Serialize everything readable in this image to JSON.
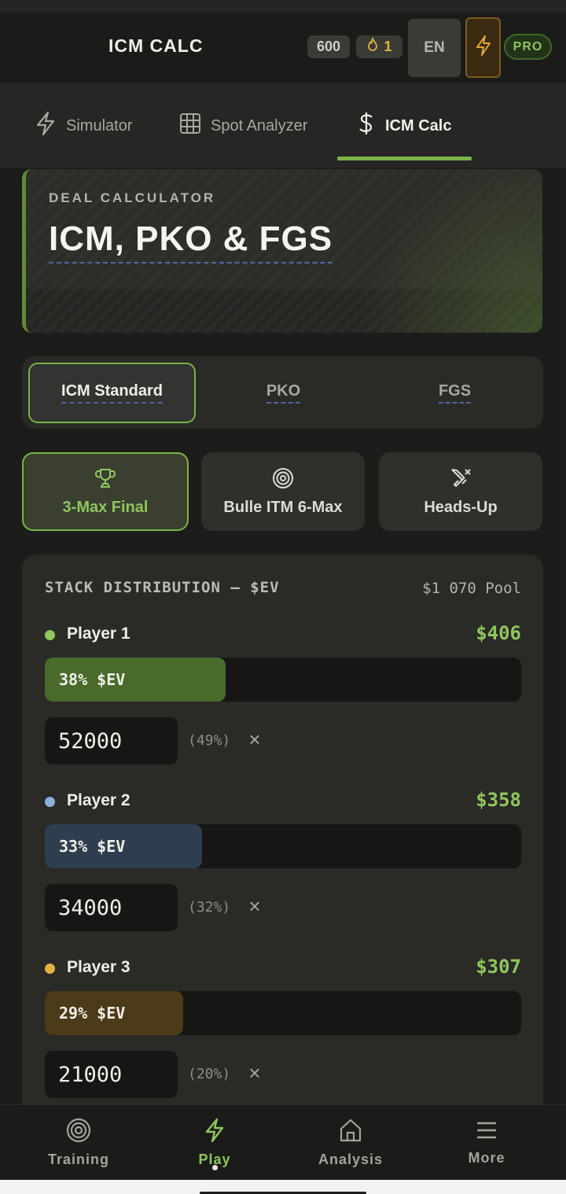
{
  "header": {
    "title": "ICM CALC",
    "credits": "600",
    "streak": "1",
    "language": "EN",
    "pro_badge": "PRO"
  },
  "tabs": [
    {
      "label": "Simulator",
      "icon": "bolt-icon",
      "active": false
    },
    {
      "label": "Spot Analyzer",
      "icon": "grid-icon",
      "active": false
    },
    {
      "label": "ICM Calc",
      "icon": "dollar-icon",
      "active": true
    }
  ],
  "hero": {
    "eyebrow": "DEAL CALCULATOR",
    "title": "ICM, PKO & FGS"
  },
  "modes": [
    {
      "label": "ICM Standard",
      "selected": true
    },
    {
      "label": "PKO",
      "selected": false
    },
    {
      "label": "FGS",
      "selected": false
    }
  ],
  "presets": [
    {
      "label": "3-Max Final",
      "icon": "trophy-icon",
      "selected": true
    },
    {
      "label": "Bulle ITM 6-Max",
      "icon": "target-icon",
      "selected": false
    },
    {
      "label": "Heads-Up",
      "icon": "swords-icon",
      "selected": false
    }
  ],
  "stack": {
    "title": "STACK DISTRIBUTION — $EV",
    "pool": "$1 070 Pool",
    "players": [
      {
        "name": "Player 1",
        "ev": "$406",
        "ev_share": 0.38,
        "bar_label": "38% $EV",
        "stack": "52000",
        "stack_pct": "(49%)",
        "color": "#8fc65d",
        "bar_color": "#4a6a2b"
      },
      {
        "name": "Player 2",
        "ev": "$358",
        "ev_share": 0.33,
        "bar_label": "33% $EV",
        "stack": "34000",
        "stack_pct": "(32%)",
        "color": "#8ab0d8",
        "bar_color": "#2f3e4f"
      },
      {
        "name": "Player 3",
        "ev": "$307",
        "ev_share": 0.29,
        "bar_label": "29% $EV",
        "stack": "21000",
        "stack_pct": "(20%)",
        "color": "#e0b33f",
        "bar_color": "#4c3b18"
      }
    ]
  },
  "bottom_nav": [
    {
      "label": "Training",
      "icon": "target-icon",
      "active": false
    },
    {
      "label": "Play",
      "icon": "bolt-icon",
      "active": true
    },
    {
      "label": "Analysis",
      "icon": "home-icon",
      "active": false
    },
    {
      "label": "More",
      "icon": "menu-icon",
      "active": false
    }
  ],
  "colors": {
    "accent": "#7bb349",
    "accent_text": "#8fc65d",
    "background": "#1c1c1a"
  }
}
